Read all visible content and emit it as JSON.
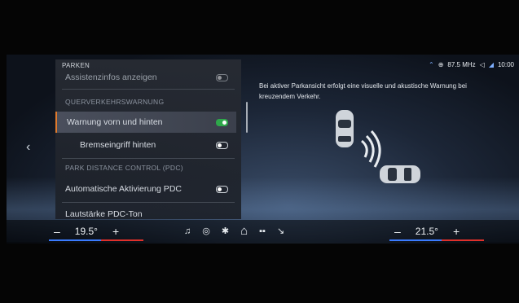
{
  "menu": {
    "title": "PARKEN",
    "rows": [
      {
        "label": "Assistenzinfos anzeigen"
      },
      {
        "label": "QUERVERKEHRSWARNUNG"
      },
      {
        "label": "Warnung vorn und hinten",
        "state": "on"
      },
      {
        "label": "Bremseingriff hinten",
        "state": "off"
      },
      {
        "label": "PARK DISTANCE CONTROL (PDC)"
      },
      {
        "label": "Automatische Aktivierung PDC",
        "state": "off"
      },
      {
        "label": "Lautstärke PDC-Ton"
      }
    ]
  },
  "status": {
    "radio": "87.5 MHz",
    "time": "10:00"
  },
  "warning_text": "Bei aktiver Parkansicht erfolgt eine visuelle und akustische Warnung bei kreuzendem Verkehr.",
  "climate": {
    "left_temp": "19.5°",
    "right_temp": "21.5°",
    "minus": "–",
    "plus": "+"
  },
  "dock": {
    "music": "♫",
    "nav": "◎",
    "fan": "✱",
    "home": "⌂",
    "apps": "▪▪",
    "phone": "↘"
  },
  "colors": {
    "accent": "#e07a2c",
    "toggle_on": "#2ea84a"
  }
}
